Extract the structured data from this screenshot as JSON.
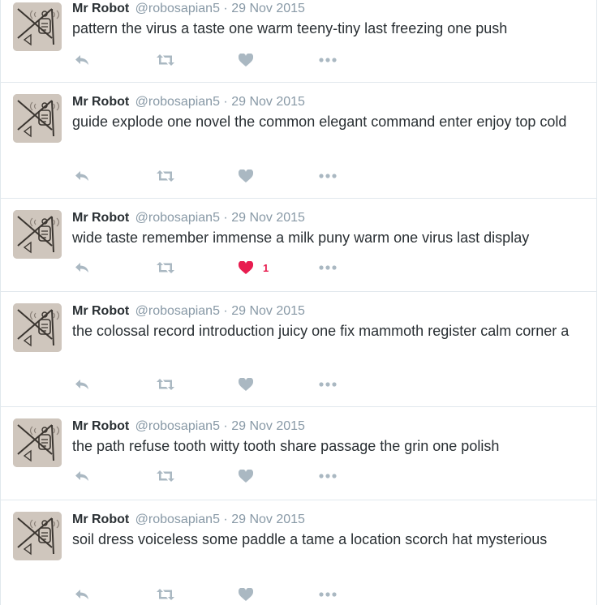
{
  "timeline": {
    "tweets": [
      {
        "name": "Mr Robot",
        "handle": "@robosapian5",
        "separator": "·",
        "date": "29 Nov 2015",
        "text": "pattern the virus a taste one warm teeny-tiny last freezing one push",
        "liked": false,
        "like_count": ""
      },
      {
        "name": "Mr Robot",
        "handle": "@robosapian5",
        "separator": "·",
        "date": "29 Nov 2015",
        "text": "guide explode one novel the common elegant command enter enjoy top cold",
        "liked": false,
        "like_count": ""
      },
      {
        "name": "Mr Robot",
        "handle": "@robosapian5",
        "separator": "·",
        "date": "29 Nov 2015",
        "text": "wide taste remember immense a milk puny warm one virus last display",
        "liked": true,
        "like_count": "1"
      },
      {
        "name": "Mr Robot",
        "handle": "@robosapian5",
        "separator": "·",
        "date": "29 Nov 2015",
        "text": "the colossal record introduction juicy one fix mammoth register calm corner a",
        "liked": false,
        "like_count": ""
      },
      {
        "name": "Mr Robot",
        "handle": "@robosapian5",
        "separator": "·",
        "date": "29 Nov 2015",
        "text": "the path refuse tooth witty tooth share passage the grin one polish",
        "liked": false,
        "like_count": ""
      },
      {
        "name": "Mr Robot",
        "handle": "@robosapian5",
        "separator": "·",
        "date": "29 Nov 2015",
        "text": "soil dress voiceless some paddle a tame a location scorch hat mysterious",
        "liked": false,
        "like_count": ""
      }
    ]
  },
  "icons": {
    "reply": "reply-icon",
    "retweet": "retweet-icon",
    "like": "heart-icon",
    "more": "more-icon"
  },
  "colors": {
    "name": "#292f33",
    "meta": "#8899a6",
    "action_icon": "#aab8c2",
    "liked": "#e81c4f",
    "divider": "#e1e8ed"
  }
}
